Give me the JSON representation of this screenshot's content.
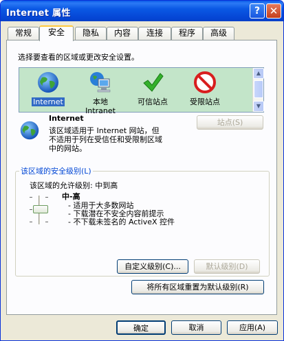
{
  "window": {
    "title": "Internet 属性",
    "help": "?",
    "close": "✕"
  },
  "tabs": [
    {
      "label": "常规"
    },
    {
      "label": "安全"
    },
    {
      "label": "隐私"
    },
    {
      "label": "内容"
    },
    {
      "label": "连接"
    },
    {
      "label": "程序"
    },
    {
      "label": "高级"
    }
  ],
  "security": {
    "instruction": "选择要查看的区域或更改安全设置。",
    "zones": [
      {
        "label": "Internet",
        "icon": "globe-icon",
        "selected": true
      },
      {
        "label": "本地\nIntranet",
        "icon": "intranet-icon",
        "selected": false
      },
      {
        "label": "可信站点",
        "icon": "checkmark-icon",
        "selected": false
      },
      {
        "label": "受限站点",
        "icon": "restricted-icon",
        "selected": false
      }
    ],
    "zone_title": "Internet",
    "zone_desc": [
      "该区域适用于 Internet 网站，但",
      "不适用于列在受信任和受限制区域",
      "中的网站。"
    ],
    "sites_button": "站点(S)",
    "group_title": "该区域的安全级别(L)",
    "allowed_levels": "该区域的允许级别: 中到高",
    "level_name": "中-高",
    "level_bullets": [
      "- 适用于大多数网站",
      "- 下载潜在不安全内容前提示",
      "- 不下载未签名的 ActiveX 控件"
    ],
    "custom_level_button": "自定义级别(C)...",
    "default_level_button": "默认级别(D)",
    "reset_all_button": "将所有区域重置为默认级别(R)"
  },
  "footer": {
    "ok": "确定",
    "cancel": "取消",
    "apply": "应用(A)"
  },
  "colors": {
    "title_bar": "#0a58e4",
    "zone_bg": "#c3e5c9",
    "selection": "#316ac5",
    "group_title": "#0046d5"
  }
}
